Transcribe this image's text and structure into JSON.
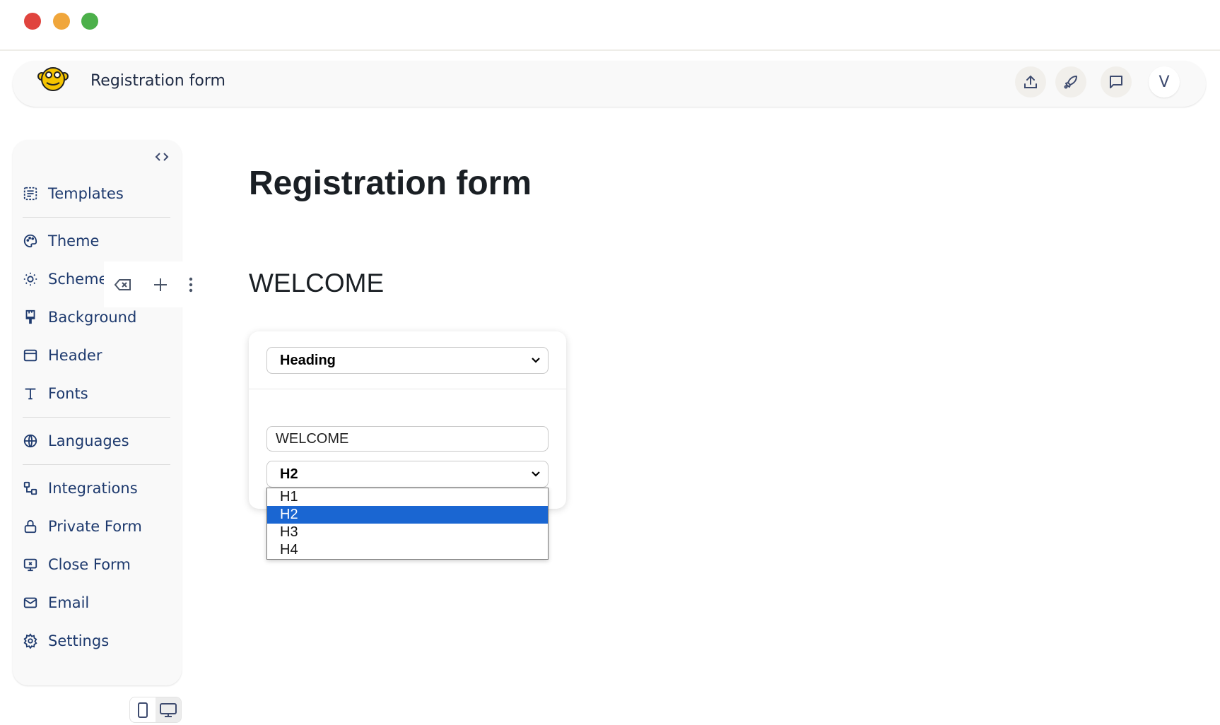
{
  "window": {
    "controls": [
      "close",
      "minimize",
      "maximize"
    ],
    "colors": {
      "close": "#e0443e",
      "minimize": "#f0a63b",
      "maximize": "#4cb04a"
    }
  },
  "header": {
    "title": "Registration form",
    "logo": "monkey-logo",
    "actions": [
      {
        "icon": "upload-icon"
      },
      {
        "icon": "rocket-icon"
      },
      {
        "icon": "comment-icon"
      }
    ],
    "avatar": "V"
  },
  "sidebar": {
    "items": [
      {
        "label": "Templates",
        "icon": "templates-icon"
      },
      {
        "label": "Theme",
        "icon": "palette-icon"
      },
      {
        "label": "Scheme",
        "icon": "sun-moon-icon"
      },
      {
        "label": "Background",
        "icon": "paint-brush-icon"
      },
      {
        "label": "Header",
        "icon": "layout-header-icon"
      },
      {
        "label": "Fonts",
        "icon": "text-icon"
      },
      {
        "label": "Languages",
        "icon": "globe-icon"
      },
      {
        "label": "Integrations",
        "icon": "integrations-icon"
      },
      {
        "label": "Private Form",
        "icon": "lock-icon"
      },
      {
        "label": "Close Form",
        "icon": "monitor-x-icon"
      },
      {
        "label": "Email",
        "icon": "mail-icon"
      },
      {
        "label": "Settings",
        "icon": "gear-icon"
      }
    ]
  },
  "main": {
    "title": "Registration form",
    "welcome": "WELCOME",
    "editor": {
      "type_select": "Heading",
      "text_value": "WELCOME",
      "level_select": "H2",
      "level_options": [
        "H1",
        "H2",
        "H3",
        "H4"
      ],
      "highlighted": "H2",
      "highlight_color": "#1a66d2"
    }
  }
}
